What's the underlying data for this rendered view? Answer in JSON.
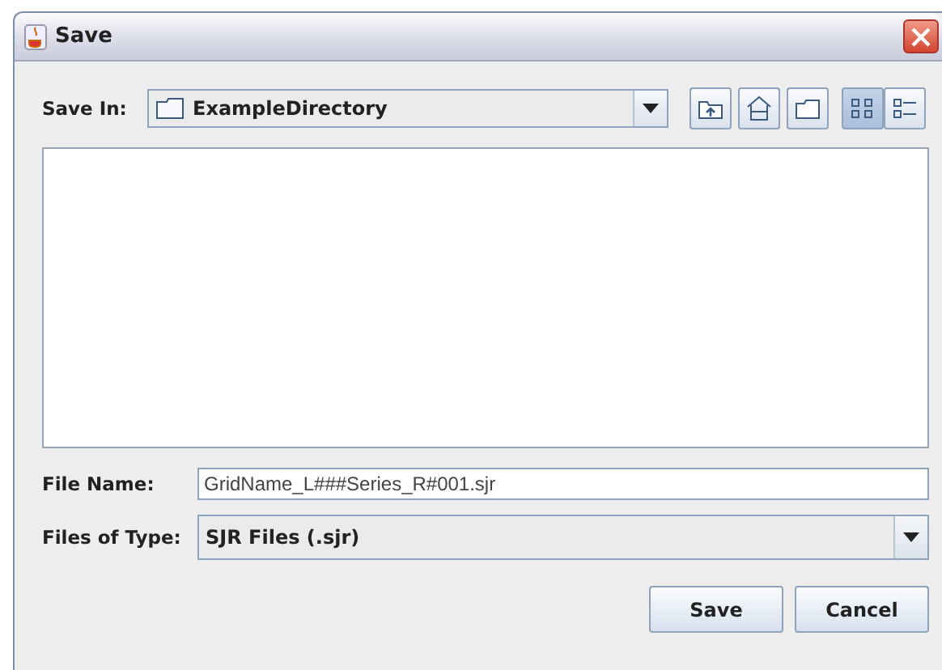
{
  "window": {
    "title": "Save"
  },
  "save_in": {
    "label": "Save In:",
    "value": "ExampleDirectory"
  },
  "toolbar": [
    {
      "kind": "up",
      "selected": false
    },
    {
      "kind": "home",
      "selected": false
    },
    {
      "kind": "new-folder",
      "selected": false
    },
    {
      "kind": "list",
      "selected": true
    },
    {
      "kind": "details",
      "selected": false
    }
  ],
  "file_name": {
    "label": "File Name:",
    "value": "GridName_L###Series_R#001.sjr"
  },
  "files_of_type": {
    "label": "Files of Type:",
    "value": "SJR Files (.sjr)"
  },
  "buttons": [
    "Save",
    "Cancel"
  ]
}
